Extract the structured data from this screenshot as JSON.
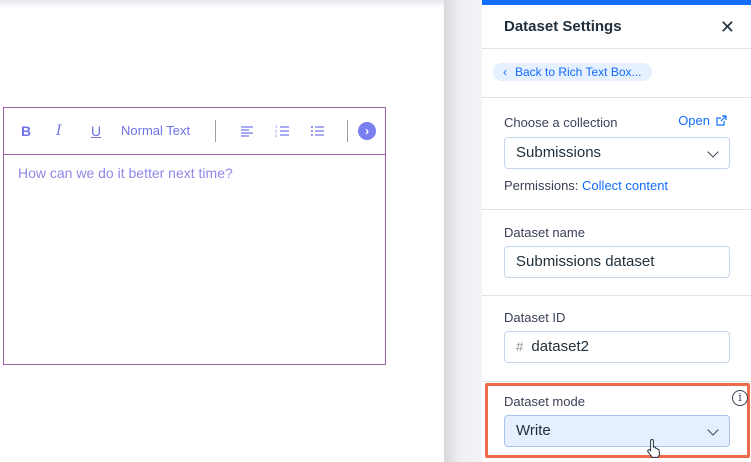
{
  "editor": {
    "toolbar": {
      "bold": "B",
      "italic": "I",
      "underline": "U",
      "text_style": "Normal Text",
      "more_icon": "chevron-right-circle-icon"
    },
    "body_text": "How can we do it better next time?"
  },
  "panel": {
    "title": "Dataset Settings",
    "close_icon": "close-icon",
    "back_label": "Back to Rich Text Box...",
    "collection": {
      "label": "Choose a collection",
      "open_label": "Open",
      "value": "Submissions"
    },
    "permissions": {
      "label": "Permissions:",
      "value": "Collect content"
    },
    "dataset_name": {
      "label": "Dataset name",
      "value": "Submissions dataset"
    },
    "dataset_id": {
      "label": "Dataset ID",
      "prefix": "#",
      "value": "dataset2"
    },
    "dataset_mode": {
      "label": "Dataset mode",
      "value": "Write",
      "info_icon": "info-icon"
    }
  },
  "colors": {
    "accent": "#116dff",
    "highlight": "#ef6a4b",
    "editor_text": "#8f88e8"
  }
}
